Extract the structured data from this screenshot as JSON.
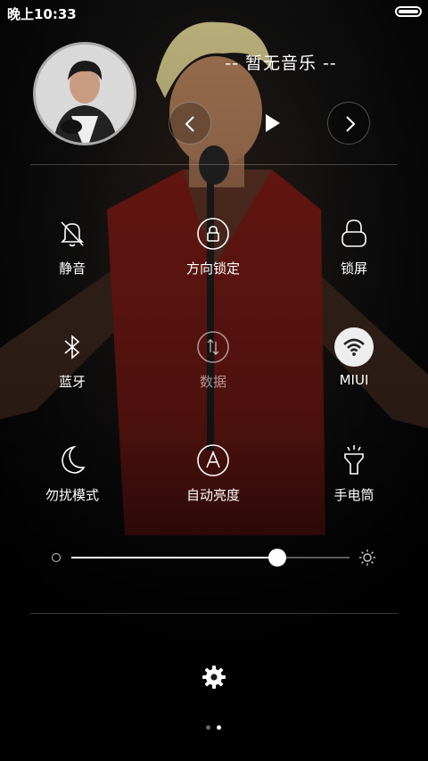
{
  "status_bar": {
    "time": "晚上10:33"
  },
  "music": {
    "title": "-- 暂无音乐 --",
    "album_art_icon": "album-art-image",
    "controls": {
      "prev_icon": "chevron-left-icon",
      "play_icon": "play-icon",
      "next_icon": "chevron-right-icon"
    }
  },
  "tiles": [
    {
      "label": "静音",
      "icon": "bell-off-icon",
      "active": false,
      "dim": false
    },
    {
      "label": "方向锁定",
      "icon": "rotation-lock-icon",
      "active": false,
      "dim": false
    },
    {
      "label": "锁屏",
      "icon": "lock-icon",
      "active": false,
      "dim": false
    },
    {
      "label": "蓝牙",
      "icon": "bluetooth-icon",
      "active": false,
      "dim": false
    },
    {
      "label": "数据",
      "icon": "mobile-data-icon",
      "active": false,
      "dim": true
    },
    {
      "label": "MIUI",
      "icon": "wifi-icon",
      "active": true,
      "dim": false
    },
    {
      "label": "勿扰模式",
      "icon": "moon-icon",
      "active": false,
      "dim": false
    },
    {
      "label": "自动亮度",
      "icon": "auto-brightness-icon",
      "active": false,
      "dim": false
    },
    {
      "label": "手电筒",
      "icon": "flashlight-icon",
      "active": false,
      "dim": false
    }
  ],
  "brightness": {
    "level_fraction": 0.74,
    "min_icon": "brightness-low-icon",
    "max_icon": "brightness-high-icon"
  },
  "settings_icon": "gear-icon",
  "pager": {
    "pages": 2,
    "current": 2
  },
  "colors": {
    "accent_active": "#eeeeee",
    "shirt": "#8c1f18",
    "background": "#0a0a0a"
  }
}
